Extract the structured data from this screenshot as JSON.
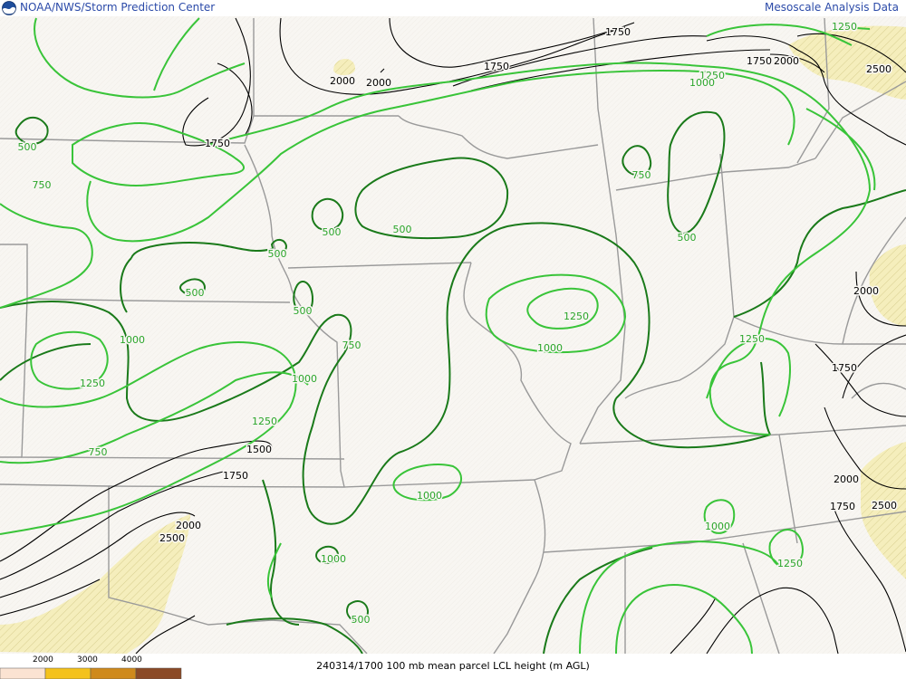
{
  "header": {
    "left_title": "NOAA/NWS/Storm Prediction Center",
    "right_title": "Mesoscale Analysis Data",
    "logo_icon": "noaa-logo-icon"
  },
  "footer": {
    "caption": "240314/1700 100 mb mean parcel LCL height (m AGL)"
  },
  "legend": {
    "labels": [
      "2000",
      "3000",
      "4000"
    ],
    "colors": [
      "#fbe3d2",
      "#f4c21c",
      "#cf8a1c",
      "#8b4a26"
    ]
  },
  "colors": {
    "background": "#f8f6f2",
    "shade_2000": "#f5eebc",
    "dark_green": "#1a7a1a",
    "bright_green": "#39c439",
    "black_contour": "#000000",
    "state_border": "#9a9a9a",
    "header_text": "#2b4aa8"
  },
  "contour_labels": [
    {
      "text": "1250",
      "color": "green"
    },
    {
      "text": "1750",
      "color": "black"
    },
    {
      "text": "1750",
      "color": "black"
    },
    {
      "text": "1250",
      "color": "green"
    },
    {
      "text": "1000",
      "color": "green"
    },
    {
      "text": "1750",
      "color": "black"
    },
    {
      "text": "2000",
      "color": "black"
    },
    {
      "text": "2500",
      "color": "black"
    },
    {
      "text": "2000",
      "color": "black"
    },
    {
      "text": "2000",
      "color": "black"
    },
    {
      "text": "500",
      "color": "green"
    },
    {
      "text": "750",
      "color": "green"
    },
    {
      "text": "1750",
      "color": "black"
    },
    {
      "text": "750",
      "color": "green"
    },
    {
      "text": "500",
      "color": "green"
    },
    {
      "text": "500",
      "color": "green"
    },
    {
      "text": "500",
      "color": "green"
    },
    {
      "text": "500",
      "color": "green"
    },
    {
      "text": "500",
      "color": "green"
    },
    {
      "text": "500",
      "color": "green"
    },
    {
      "text": "1250",
      "color": "green"
    },
    {
      "text": "1000",
      "color": "green"
    },
    {
      "text": "1000",
      "color": "green"
    },
    {
      "text": "750",
      "color": "green"
    },
    {
      "text": "1250",
      "color": "green"
    },
    {
      "text": "1000",
      "color": "green"
    },
    {
      "text": "1250",
      "color": "green"
    },
    {
      "text": "1250",
      "color": "green"
    },
    {
      "text": "2000",
      "color": "black"
    },
    {
      "text": "1750",
      "color": "black"
    },
    {
      "text": "750",
      "color": "green"
    },
    {
      "text": "1500",
      "color": "black"
    },
    {
      "text": "1750",
      "color": "black"
    },
    {
      "text": "1000",
      "color": "green"
    },
    {
      "text": "2000",
      "color": "black"
    },
    {
      "text": "2500",
      "color": "black"
    },
    {
      "text": "1000",
      "color": "green"
    },
    {
      "text": "1000",
      "color": "green"
    },
    {
      "text": "1250",
      "color": "green"
    },
    {
      "text": "2000",
      "color": "black"
    },
    {
      "text": "1750",
      "color": "black"
    },
    {
      "text": "2500",
      "color": "black"
    },
    {
      "text": "500",
      "color": "green"
    }
  ]
}
